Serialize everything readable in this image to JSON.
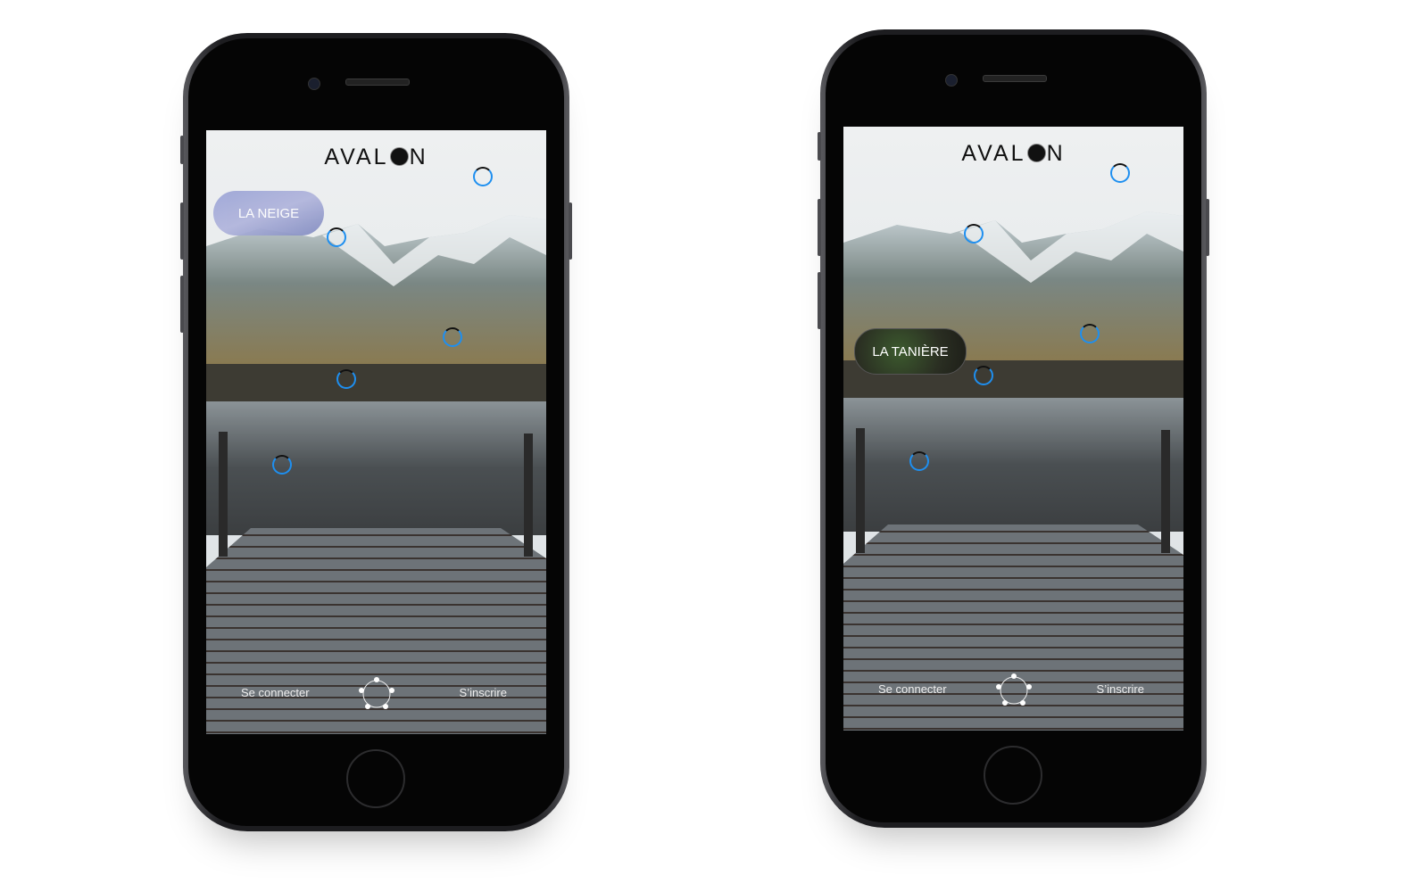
{
  "phones": [
    {
      "logo": {
        "left": "AVAL",
        "right": "N"
      },
      "tooltip": "LA NEIGE",
      "footer": {
        "login": "Se connecter",
        "signup": "S’inscrire"
      }
    },
    {
      "logo": {
        "left": "AVAL",
        "right": "N"
      },
      "tooltip": "LA TANIÈRE",
      "footer": {
        "login": "Se connecter",
        "signup": "S’inscrire"
      }
    }
  ],
  "colors": {
    "hotspot": "#1e8ff0",
    "neige_pill": "#9aa3d6",
    "taniere_pill": "#2a2e22"
  },
  "icons": {
    "menu": "pentagon-dots-menu-icon",
    "hotspot": "circle-hotspot-icon"
  }
}
